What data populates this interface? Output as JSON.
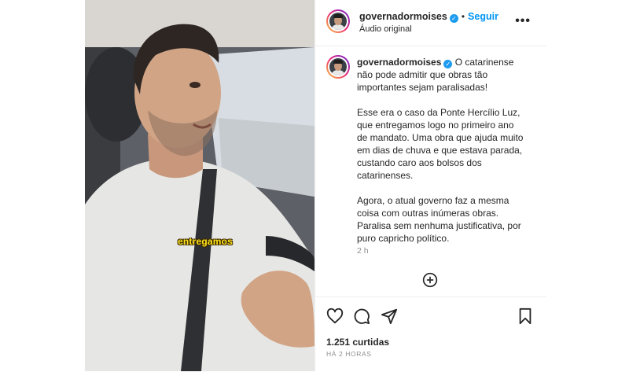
{
  "post": {
    "username": "governadormoises",
    "follow_label": "Seguir",
    "separator": "•",
    "audio_label": "Áudio original",
    "more_label": "•••",
    "video_overlay_text": "entregamos",
    "caption_paragraphs": [
      "O catarinense não pode admitir que obras tão importantes sejam paralisadas!",
      "Esse era o caso da Ponte Hercílio Luz, que entregamos logo no primeiro ano de mandato. Uma obra que ajuda muito em dias de chuva e que estava parada, custando caro aos bolsos dos catarinenses.",
      "Agora, o atual governo faz a mesma coisa com outras inúmeras obras. Paralisa sem nenhuma justificativa, por puro capricho político."
    ],
    "time_label": "2 h",
    "likes_label": "1.251 curtidas",
    "posted_ago": "HÁ 2 HORAS"
  },
  "icons": {
    "verified": "verified-badge-icon",
    "add": "add-comment-icon",
    "like": "heart-icon",
    "comment": "comment-icon",
    "share": "share-icon",
    "save": "bookmark-icon"
  },
  "colors": {
    "link_blue": "#0095f6",
    "verified_blue": "#1d9bf0",
    "muted_text": "#8e8e8e",
    "overlay_text": "#ffe21a"
  }
}
